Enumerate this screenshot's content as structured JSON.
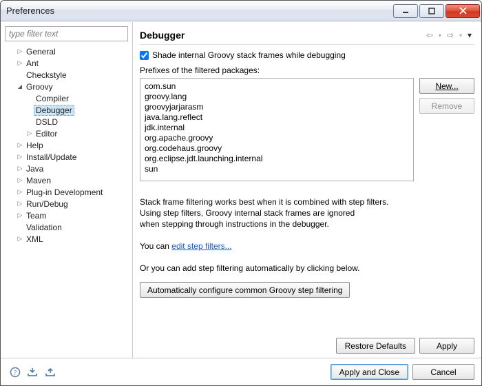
{
  "window": {
    "title": "Preferences"
  },
  "filter": {
    "placeholder": "type filter text"
  },
  "tree": {
    "items": [
      {
        "label": "General"
      },
      {
        "label": "Ant"
      },
      {
        "label": "Checkstyle"
      },
      {
        "label": "Groovy",
        "open": true,
        "children": [
          {
            "label": "Compiler"
          },
          {
            "label": "Debugger",
            "selected": true
          },
          {
            "label": "DSLD"
          },
          {
            "label": "Editor",
            "expandable": true
          }
        ]
      },
      {
        "label": "Help"
      },
      {
        "label": "Install/Update"
      },
      {
        "label": "Java"
      },
      {
        "label": "Maven"
      },
      {
        "label": "Plug-in Development"
      },
      {
        "label": "Run/Debug"
      },
      {
        "label": "Team"
      },
      {
        "label": "Validation"
      },
      {
        "label": "XML"
      }
    ]
  },
  "page": {
    "title": "Debugger",
    "checkbox_label": "Shade internal Groovy stack frames while debugging",
    "checkbox_checked": true,
    "prefixes_label": "Prefixes of the filtered packages:",
    "prefixes": [
      "com.sun",
      "groovy.lang",
      "groovyjarjarasm",
      "java.lang.reflect",
      "jdk.internal",
      "org.apache.groovy",
      "org.codehaus.groovy",
      "org.eclipse.jdt.launching.internal",
      "sun"
    ],
    "new_btn": "New...",
    "remove_btn": "Remove",
    "info_line1": "Stack frame filtering works best when it is combined with step filters.",
    "info_line2": "Using step filters, Groovy internal stack frames are ignored",
    "info_line3": "when stepping through instructions in the debugger.",
    "you_can": "You can ",
    "edit_link": "edit step filters...",
    "or_add": "Or you can add step filtering automatically by clicking below.",
    "auto_btn": "Automatically configure common Groovy step filtering",
    "restore_btn": "Restore Defaults",
    "apply_btn": "Apply"
  },
  "footer": {
    "apply_close": "Apply and Close",
    "cancel": "Cancel"
  }
}
